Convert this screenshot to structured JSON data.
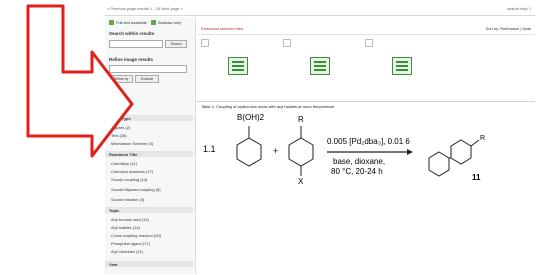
{
  "topbar": {
    "left_text": "« Previous page  results 1 - 24  Next page »",
    "right_text": "search help  ?"
  },
  "sidebar": {
    "filter_full": "Full text available",
    "filter_abstract": "Abstract only",
    "search_within_title": "Search within results",
    "search_button": "Search",
    "refine_title": "Refine image results",
    "refine_button": "Refine by",
    "exclude_button": "Exclude",
    "clear_label": "Clear (2)",
    "image_type_header": "Image Type",
    "items_a": [
      "Figures (2)",
      "Text (28)",
      "Mechanism Scheme (3)"
    ],
    "sub_header_1": "Reactions Title",
    "items_b": [
      "Chemistry (11)",
      "Chemical reactions (17)",
      "Suzuki coupling (14)",
      "Suzuki-Miyaura coupling (8)",
      "Suzuki reaction (3)"
    ],
    "sub_header_2": "Topic",
    "items_c": [
      "Aryl boronic acid (13)",
      "Aryl halides (14)",
      "Cross coupling reaction (20)",
      "Phosphine ligand (17)",
      "Aryl chlorides (11)"
    ],
    "sub_header_3": "Year"
  },
  "main": {
    "bar_left": "Download selected files",
    "bar_right": "Sort by: Relevance | Date"
  },
  "figure": {
    "caption": "Table 1: Coupling of arylboronic acids with aryl halides at room temperature",
    "reactant_b": "B(OH)2",
    "reactant_r": "R",
    "reactant_x": "X",
    "coef": "1.1",
    "plus": "+",
    "cond1": "0.005 [Pd₂dba₃], 0.01 6",
    "cond2": "base, dioxane,",
    "cond3": "80 °C, 20-24 h",
    "product_r": "R",
    "product_num": "11"
  }
}
